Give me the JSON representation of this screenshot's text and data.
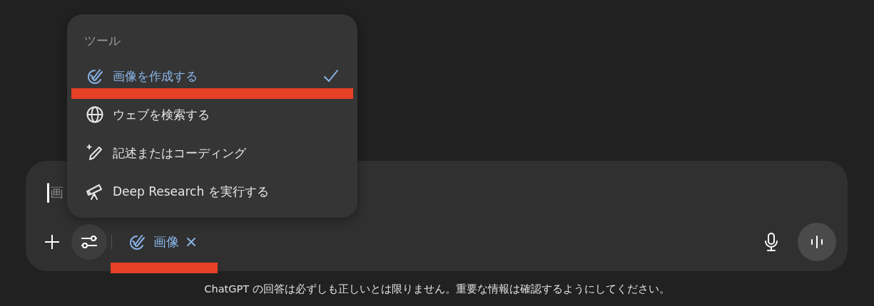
{
  "tools_menu": {
    "header": "ツール",
    "items": [
      {
        "kind": "image",
        "label": "画像を作成する",
        "selected": true
      },
      {
        "kind": "web",
        "label": "ウェブを検索する",
        "selected": false
      },
      {
        "kind": "write",
        "label": "記述またはコーディング",
        "selected": false
      },
      {
        "kind": "research",
        "label": "Deep Research を実行する",
        "selected": false
      }
    ]
  },
  "composer": {
    "placeholder": "画",
    "active_tool": {
      "kind": "image",
      "label": "画像"
    }
  },
  "footer": "ChatGPT の回答は必ずしも正しいとは限りません。重要な情報は確認するようにしてください。"
}
